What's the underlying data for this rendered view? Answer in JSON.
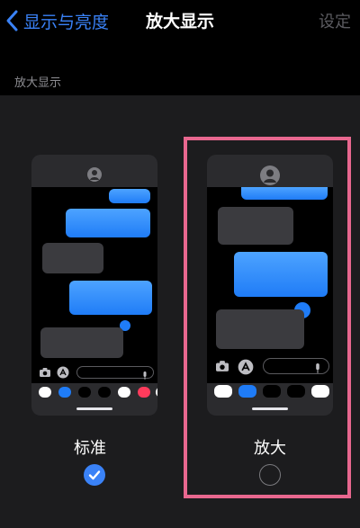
{
  "nav": {
    "back_label": "显示与亮度",
    "title": "放大显示",
    "action_label": "设定"
  },
  "section": {
    "header": "放大显示"
  },
  "options": [
    {
      "label": "标准",
      "selected": true
    },
    {
      "label": "放大",
      "selected": false
    }
  ],
  "colors": {
    "accent": "#3a82f7",
    "highlight": "#e8678f",
    "background": "#1c1c1e"
  }
}
